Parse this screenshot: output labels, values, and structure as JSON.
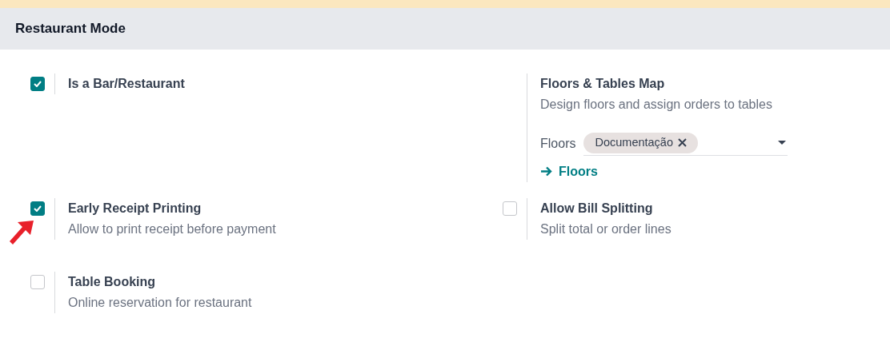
{
  "section": {
    "title": "Restaurant Mode"
  },
  "settings": [
    {
      "kind": "checkbox",
      "checked": true,
      "title": "Is a Bar/Restaurant"
    },
    {
      "kind": "info",
      "title": "Floors & Tables Map",
      "description": "Design floors and assign orders to tables",
      "field": {
        "label": "Floors",
        "tags": [
          "Documentação"
        ]
      },
      "link": {
        "label": "Floors"
      }
    },
    {
      "kind": "checkbox",
      "checked": true,
      "title": "Early Receipt Printing",
      "description": "Allow to print receipt before payment",
      "highlighted": true
    },
    {
      "kind": "checkbox",
      "checked": false,
      "title": "Allow Bill Splitting",
      "description": "Split total or order lines"
    },
    {
      "kind": "checkbox",
      "checked": false,
      "title": "Table Booking",
      "description": "Online reservation for restaurant"
    }
  ]
}
